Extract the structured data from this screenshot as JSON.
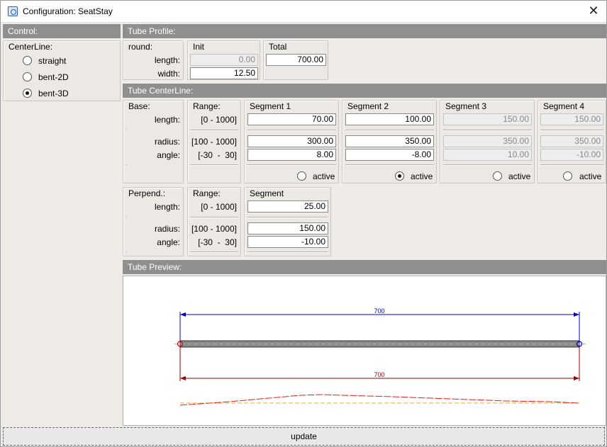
{
  "window": {
    "title": "Configuration: SeatStay",
    "close_glyph": "✕"
  },
  "control": {
    "header": "Control:",
    "group_title": "CenterLine:",
    "options": [
      {
        "label": "straight",
        "checked": false
      },
      {
        "label": "bent-2D",
        "checked": false
      },
      {
        "label": "bent-3D",
        "checked": true
      }
    ]
  },
  "profile": {
    "header": "Tube Profile:",
    "round_title": "round:",
    "length_label": "length:",
    "width_label": "width:",
    "init_title": "Init",
    "init_length": "0.00",
    "init_width": "12.50",
    "total_title": "Total",
    "total_value": "700.00"
  },
  "centerline": {
    "header": "Tube CenterLine:",
    "base": {
      "title": "Base:",
      "length_label": "length:",
      "radius_label": "radius:",
      "angle_label": "angle:",
      "dot": "."
    },
    "range": {
      "title": "Range:",
      "length": "[0 - 1000]",
      "radius": "[100 - 1000]",
      "angle": "[-30  -  30]"
    },
    "segments": [
      {
        "title": "Segment 1",
        "length": "70.00",
        "radius": "300.00",
        "angle": "8.00",
        "active_label": "",
        "active": false,
        "enabled": true
      },
      {
        "title": "Segment 2",
        "length": "100.00",
        "radius": "350.00",
        "angle": "-8.00",
        "active_label": "active",
        "active": true,
        "enabled": true
      },
      {
        "title": "Segment 3",
        "length": "150.00",
        "radius": "350.00",
        "angle": "10.00",
        "active_label": "active",
        "active": false,
        "enabled": false
      },
      {
        "title": "Segment 4",
        "length": "150.00",
        "radius": "350.00",
        "angle": "-10.00",
        "active_label": "active",
        "active": false,
        "enabled": false
      }
    ],
    "seg1_active_label": "active",
    "perpend": {
      "title": "Perpend.:",
      "length_label": "length:",
      "radius_label": "radius:",
      "angle_label": "angle:",
      "range_title": "Range:",
      "range_length": "[0 - 1000]",
      "range_radius": "[100 - 1000]",
      "range_angle": "[-30  -  30]",
      "segment_title": "Segment",
      "length": "25.00",
      "radius": "150.00",
      "angle": "-10.00"
    }
  },
  "preview": {
    "header": "Tube Preview:",
    "top_dimension": "700",
    "bottom_dimension": "700",
    "colors": {
      "top_dim": "#0000cc",
      "bottom_dim": "#990000",
      "tube_fill": "#8a8a8a",
      "centerline": "#f5a623",
      "curve": "#e02020"
    }
  },
  "update_label": "update"
}
